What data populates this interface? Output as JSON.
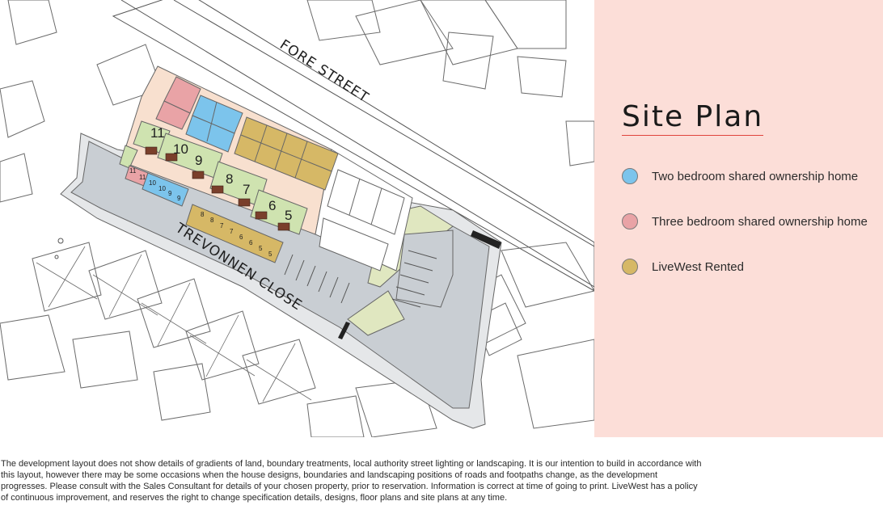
{
  "legend": {
    "title": "Site Plan",
    "items": [
      {
        "label": "Two bedroom shared ownership home",
        "color": "#7cc4ec"
      },
      {
        "label": "Three bedroom shared ownership home",
        "color": "#e9a3a6"
      },
      {
        "label": "LiveWest Rented",
        "color": "#d6b866"
      }
    ]
  },
  "map": {
    "streets": [
      "FORE STREET",
      "TREVONNEN CLOSE"
    ],
    "plots": [
      "11",
      "10",
      "9",
      "8",
      "7",
      "6",
      "5"
    ],
    "small_plots": [
      "11",
      "11",
      "10",
      "10",
      "9",
      "9",
      "8",
      "8",
      "7",
      "7",
      "6",
      "6",
      "5",
      "5"
    ],
    "colors": {
      "road": "#c9ced3",
      "garden": "#cfe3b0",
      "shared_two_bed": "#7cc4ec",
      "shared_three_bed": "#e9a3a6",
      "rented": "#d6b866",
      "courtyard": "#f8e0cf",
      "green_space": "#e0e7c0"
    }
  },
  "disclaimer": "The development layout does not show details of gradients of land, boundary treatments, local authority street lighting or landscaping. It is our intention to build in accordance with this layout, however there may be some occasions when the house designs, boundaries and landscaping positions of roads and footpaths change, as the development progresses. Please consult with the Sales Consultant for details of your chosen property, prior to reservation. Information is correct at time of going to print. LiveWest has a policy of continuous improvement, and reserves the right to change specification details, designs, floor plans and site plans at any time."
}
